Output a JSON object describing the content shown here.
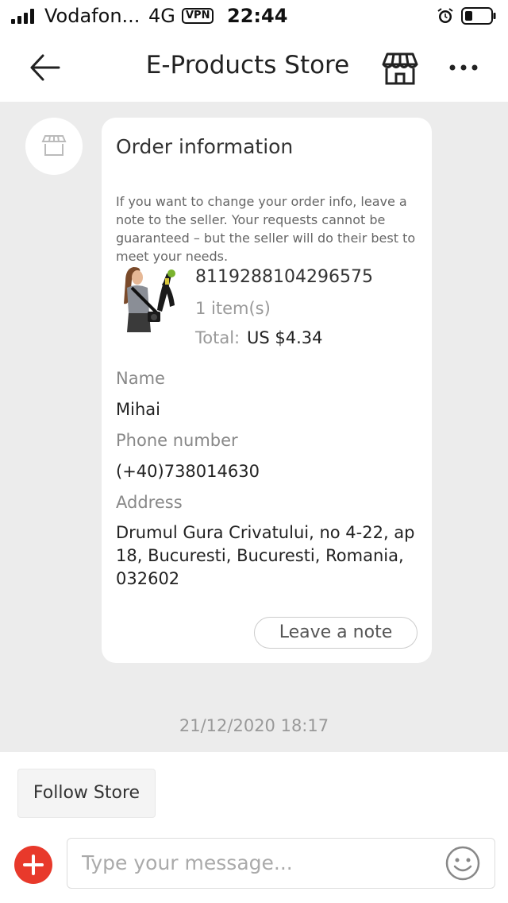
{
  "status_bar": {
    "carrier": "Vodafon...",
    "network": "4G",
    "vpn": "VPN",
    "time": "22:44"
  },
  "header": {
    "title": "E-Products Store",
    "icons": [
      "back-arrow-icon",
      "storefront-icon",
      "more-dots-icon"
    ]
  },
  "order_card": {
    "title": "Order information",
    "description": "If you want to change your order info, leave a note to the seller. Your requests cannot be guaranteed – but the seller will do their best to meet your needs.",
    "order_number": "8119288104296575",
    "item_count": "1 item(s)",
    "total_label": "Total:",
    "total_value": "US $4.34",
    "name_label": "Name",
    "name_value": "Mihai",
    "phone_label": "Phone number",
    "phone_value": "(+40)738014630",
    "address_label": "Address",
    "address_value": "Drumul Gura Crivatului, no 4-22, ap 18, Bucuresti, Bucuresti, Romania, 032602",
    "leave_note_label": "Leave a note"
  },
  "timestamp": "21/12/2020 18:17",
  "bottom": {
    "follow_store_label": "Follow Store",
    "message_placeholder": "Type your message..."
  },
  "colors": {
    "accent_red": "#e8392b",
    "chat_background": "#ececec"
  }
}
